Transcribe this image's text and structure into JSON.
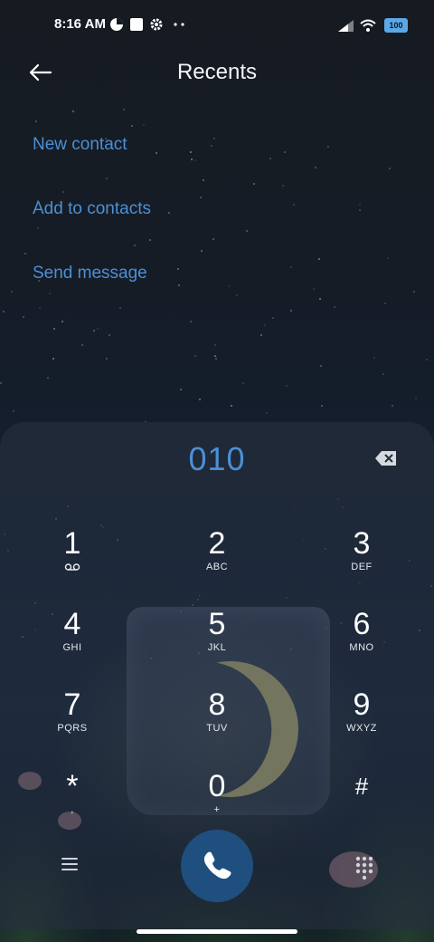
{
  "status_bar": {
    "time": "8:16 AM",
    "battery": "100"
  },
  "header": {
    "title": "Recents"
  },
  "actions": [
    {
      "label": "New contact"
    },
    {
      "label": "Add to contacts"
    },
    {
      "label": "Send message"
    }
  ],
  "dialer": {
    "number": "010",
    "keys": [
      {
        "digit": "1",
        "letters": ""
      },
      {
        "digit": "2",
        "letters": "ABC"
      },
      {
        "digit": "3",
        "letters": "DEF"
      },
      {
        "digit": "4",
        "letters": "GHI"
      },
      {
        "digit": "5",
        "letters": "JKL"
      },
      {
        "digit": "6",
        "letters": "MNO"
      },
      {
        "digit": "7",
        "letters": "PQRS"
      },
      {
        "digit": "8",
        "letters": "TUV"
      },
      {
        "digit": "9",
        "letters": "WXYZ"
      },
      {
        "digit": "*",
        "letters": ","
      },
      {
        "digit": "0",
        "letters": "+"
      },
      {
        "digit": "#",
        "letters": ""
      }
    ]
  },
  "colors": {
    "accent": "#4a90d6",
    "call_button": "#1e4f7e"
  },
  "icons": [
    "back-arrow-icon",
    "backspace-icon",
    "voicemail-icon",
    "menu-icon",
    "phone-icon",
    "dialpad-icon"
  ]
}
